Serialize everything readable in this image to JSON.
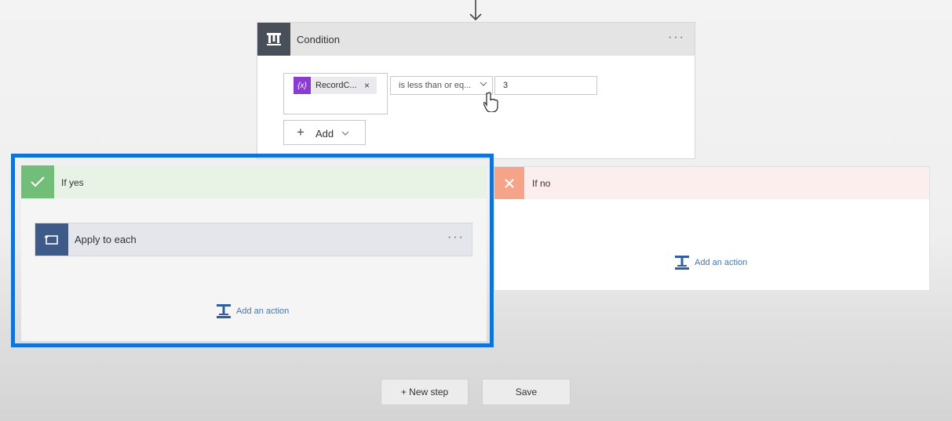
{
  "condition": {
    "title": "Condition",
    "menu": "···",
    "token_label": "RecordC...",
    "token_icon": "{x}",
    "token_remove": "×",
    "operator": "is less than or eq...",
    "value": "3",
    "add_label": "Add",
    "add_plus": "+"
  },
  "if_yes": {
    "label": "If yes",
    "apply_to_each": "Apply to each",
    "menu": "···",
    "add_action": "Add an action"
  },
  "if_no": {
    "label": "If no",
    "add_action": "Add an action"
  },
  "footer": {
    "new_step": "+ New step",
    "save": "Save"
  },
  "colors": {
    "condition_icon_bg": "#484f58",
    "yes_accent": "#72bd78",
    "no_accent": "#f5a48a",
    "apply_icon_bg": "#3e5a88",
    "highlight_outline": "#1273d6",
    "link": "#3e78b9"
  }
}
